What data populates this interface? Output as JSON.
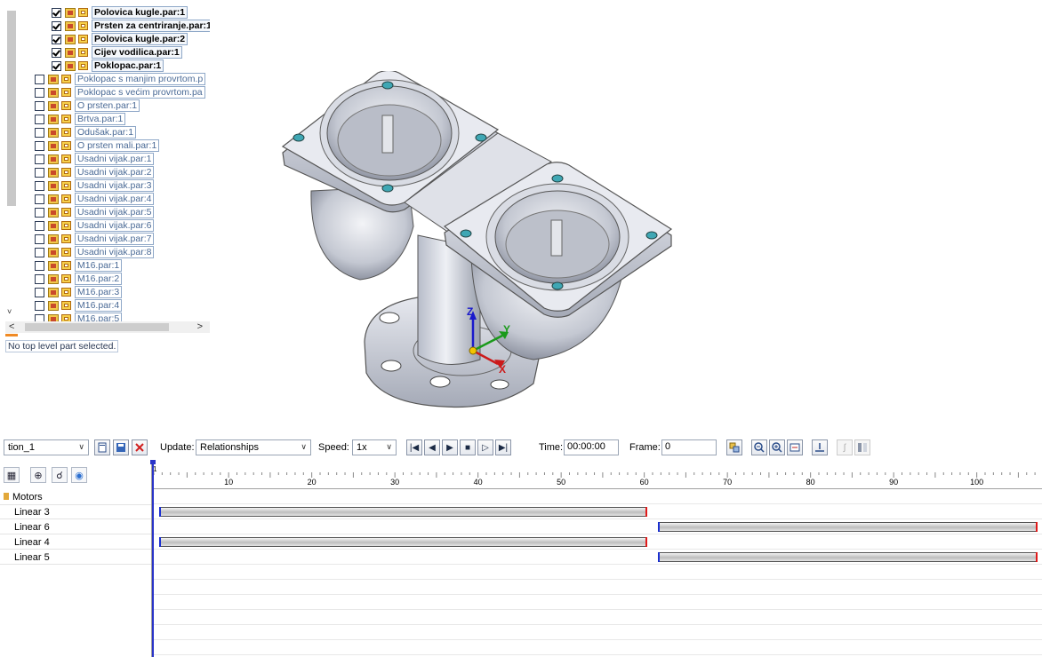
{
  "tree": {
    "items": [
      {
        "label": "Polovica kugle.par:1",
        "checked": true
      },
      {
        "label": "Prsten za centriranje.par:1",
        "checked": true
      },
      {
        "label": "Polovica kugle.par:2",
        "checked": true
      },
      {
        "label": "Cijev vodilica.par:1",
        "checked": true
      },
      {
        "label": "Poklopac.par:1",
        "checked": true
      },
      {
        "label": "Poklopac s manjim provrtom.p",
        "checked": false
      },
      {
        "label": "Poklopac s većim provrtom.pa",
        "checked": false
      },
      {
        "label": "O prsten.par:1",
        "checked": false
      },
      {
        "label": "Brtva.par:1",
        "checked": false
      },
      {
        "label": "Odušak.par:1",
        "checked": false
      },
      {
        "label": "O prsten mali.par:1",
        "checked": false
      },
      {
        "label": "Usadni vijak.par:1",
        "checked": false
      },
      {
        "label": "Usadni vijak.par:2",
        "checked": false
      },
      {
        "label": "Usadni vijak.par:3",
        "checked": false
      },
      {
        "label": "Usadni vijak.par:4",
        "checked": false
      },
      {
        "label": "Usadni vijak.par:5",
        "checked": false
      },
      {
        "label": "Usadni vijak.par:6",
        "checked": false
      },
      {
        "label": "Usadni vijak.par:7",
        "checked": false
      },
      {
        "label": "Usadni vijak.par:8",
        "checked": false
      },
      {
        "label": "M16.par:1",
        "checked": false
      },
      {
        "label": "M16.par:2",
        "checked": false
      },
      {
        "label": "M16.par:3",
        "checked": false
      },
      {
        "label": "M16.par:4",
        "checked": false
      },
      {
        "label": "M16.par:5",
        "checked": false
      }
    ],
    "scroll_left": "<",
    "scroll_right": ">",
    "collapse_mark": "˅",
    "status": "No top level part selected."
  },
  "triad": {
    "z": "Z",
    "y": "Y",
    "x": "X"
  },
  "toolbar": {
    "animation_name": "tion_1",
    "update_label": "Update:",
    "update_value": "Relationships",
    "speed_label": "Speed:",
    "speed_value": "1x",
    "time_label": "Time:",
    "time_value": "00:00:00",
    "frame_label": "Frame:",
    "frame_value": "0",
    "dropdown_arrow": "∨"
  },
  "timeline": {
    "start_marker": "1",
    "ticks": [
      10,
      20,
      30,
      40,
      50,
      60,
      70,
      80,
      90,
      100
    ],
    "group_label": "Motors",
    "tracks": [
      {
        "label": "Linear 3",
        "start": 1,
        "end": 60
      },
      {
        "label": "Linear 6",
        "start": 61,
        "end": 107
      },
      {
        "label": "Linear 4",
        "start": 1,
        "end": 60
      },
      {
        "label": "Linear 5",
        "start": 61,
        "end": 107
      }
    ]
  },
  "colors": {
    "accent": "#2a34c8",
    "bar_start": "#1a2fd0",
    "bar_end": "#e01a1a",
    "hole_teal": "#3fa7b4"
  }
}
